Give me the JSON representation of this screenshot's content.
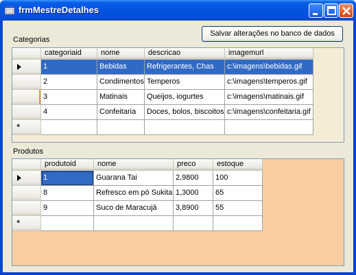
{
  "window": {
    "title": "frmMestreDetalhes",
    "icon": "form-window-icon",
    "controls": [
      "minimize-icon",
      "maximize-icon",
      "close-icon"
    ]
  },
  "toolbar": {
    "save_label": "Salvar alterações no banco de dados"
  },
  "categorias": {
    "label": "Categorias",
    "columns": [
      "categoriaid",
      "nome",
      "descricao",
      "imagemurl"
    ],
    "rows": [
      [
        "1",
        "Bebidas",
        "Refrigerantes, Chas",
        "c:\\imagens\\bebidas.gif"
      ],
      [
        "2",
        "Condimentos",
        "Temperos",
        "c:\\imagens\\temperos.gif"
      ],
      [
        "3",
        "Matinais",
        "Queijos, iogurtes",
        "c:\\imagens\\matinais.gif"
      ],
      [
        "4",
        "Confeitaria",
        "Doces, bolos, biscoitos",
        "c:\\imagens\\confeitaria.gif"
      ]
    ],
    "selected_row": 0,
    "new_row_marker": "*"
  },
  "produtos": {
    "label": "Produtos",
    "columns": [
      "produtoid",
      "nome",
      "preco",
      "estoque"
    ],
    "rows": [
      [
        "1",
        "Guarana Tai",
        "2,9800",
        "100"
      ],
      [
        "8",
        "Refresco em pó Sukita",
        "1,3000",
        "65"
      ],
      [
        "9",
        "Suco de Maracujá",
        "3,8900",
        "55"
      ]
    ],
    "new_row_marker": "*"
  },
  "colors": {
    "title_bar": "#0453e0",
    "selection": "#316ac5",
    "categorias_background": "#f5ecd8",
    "produtos_background": "#f8cda0"
  }
}
